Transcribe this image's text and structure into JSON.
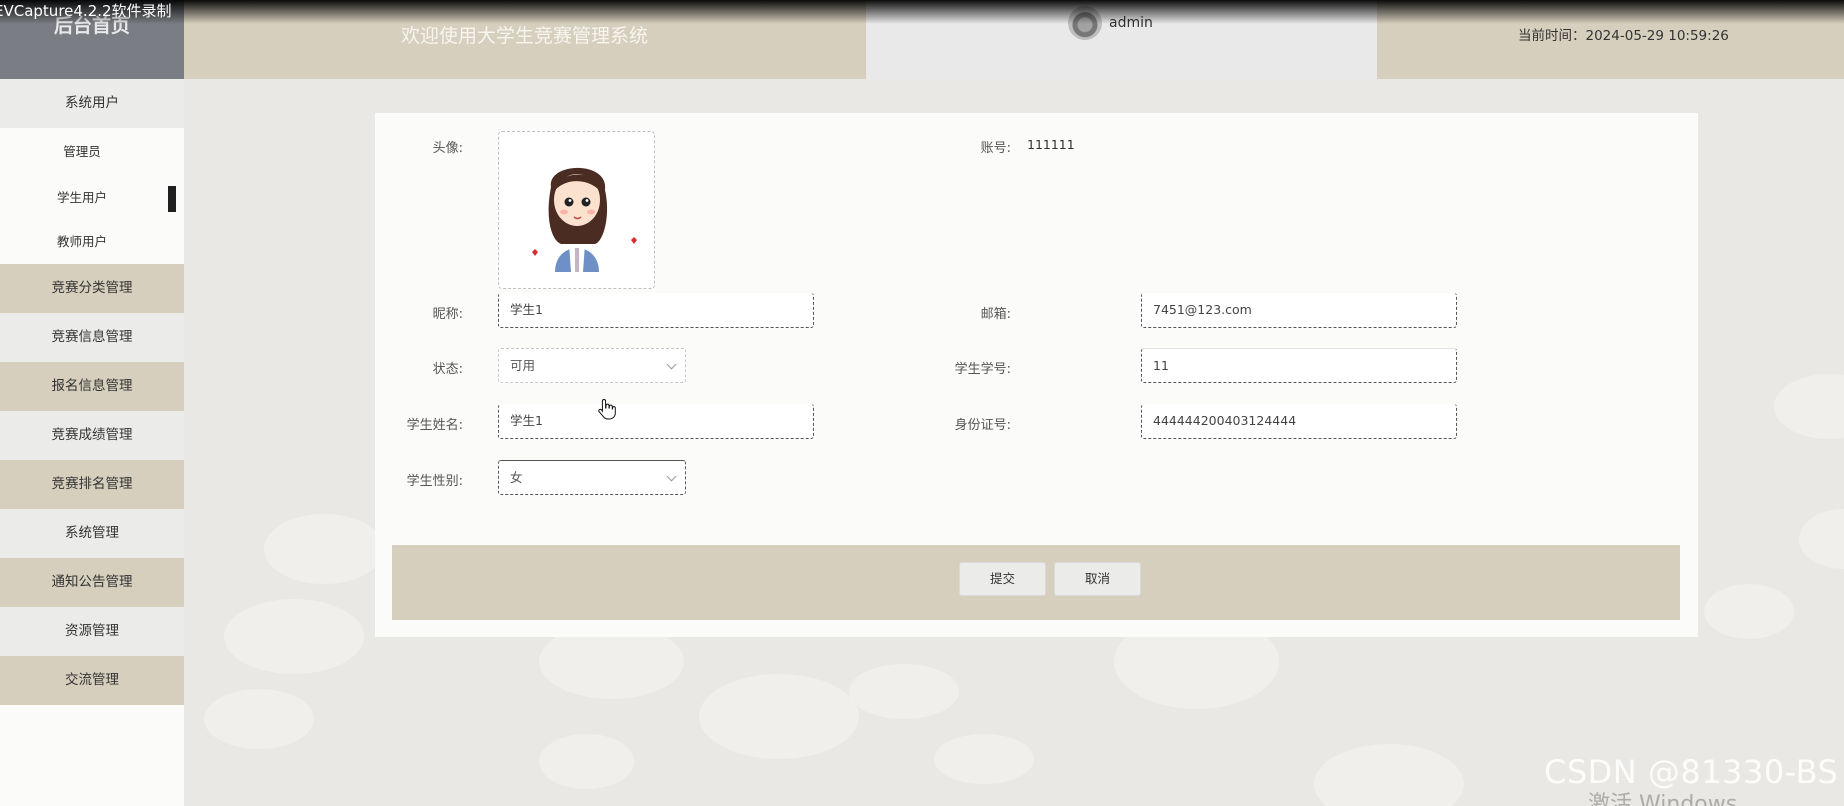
{
  "recorder": {
    "label": "EVCapture4.2.2软件录制"
  },
  "header": {
    "brand": "后台首页",
    "welcome": "欢迎使用大学生竞赛管理系统",
    "username": "admin",
    "time": "当前时间：2024-05-29 10:59:26"
  },
  "sidebar": {
    "items": [
      {
        "label": "系统用户"
      },
      {
        "label": "管理员"
      },
      {
        "label": "学生用户"
      },
      {
        "label": "教师用户"
      },
      {
        "label": "竞赛分类管理"
      },
      {
        "label": "竞赛信息管理"
      },
      {
        "label": "报名信息管理"
      },
      {
        "label": "竞赛成绩管理"
      },
      {
        "label": "竞赛排名管理"
      },
      {
        "label": "系统管理"
      },
      {
        "label": "通知公告管理"
      },
      {
        "label": "资源管理"
      },
      {
        "label": "交流管理"
      }
    ]
  },
  "form": {
    "avatar_label": "头像:",
    "account_label": "账号:",
    "account_value": "111111",
    "nickname_label": "昵称:",
    "nickname_value": "学生1",
    "email_label": "邮箱:",
    "email_value": "7451@123.com",
    "status_label": "状态:",
    "status_value": "可用",
    "student_no_label": "学生学号:",
    "student_no_value": "11",
    "student_name_label": "学生姓名:",
    "student_name_value": "学生1",
    "id_card_label": "身份证号:",
    "id_card_value": "444444200403124444",
    "gender_label": "学生性别:",
    "gender_value": "女",
    "submit_label": "提交",
    "cancel_label": "取消"
  },
  "watermark": {
    "csdn": "CSDN @81330-BS",
    "windows": "激活 Windows"
  },
  "colors": {
    "tan": "#d7cfbd",
    "light_gray": "#ebebe9",
    "brand_bg": "#7a7d83"
  }
}
